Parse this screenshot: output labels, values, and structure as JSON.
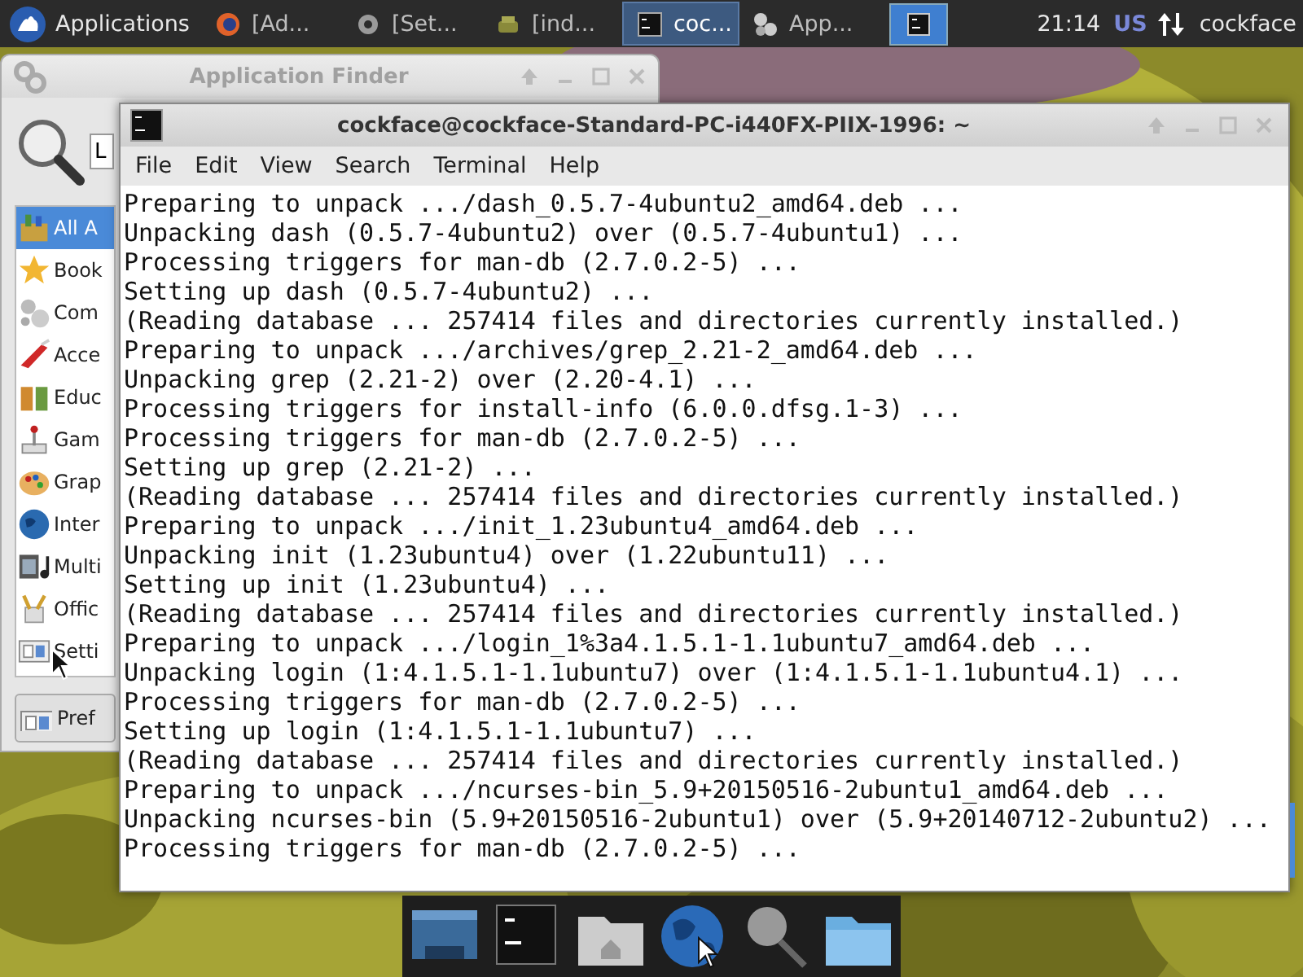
{
  "panel": {
    "menu_label": "Applications",
    "tasks": [
      {
        "label": "[Ad...",
        "kind": "browser",
        "selected": false
      },
      {
        "label": "[Set...",
        "kind": "gear",
        "selected": false
      },
      {
        "label": "[ind...",
        "kind": "package",
        "selected": false
      },
      {
        "label": "coc...",
        "kind": "terminal",
        "selected": true
      },
      {
        "label": "App...",
        "kind": "gears",
        "selected": false
      }
    ],
    "clock": "21:14",
    "layout": "US",
    "user": "cockface"
  },
  "finder": {
    "title": "Application Finder",
    "search_value": "L",
    "categories": [
      {
        "label": "All A",
        "kind": "all",
        "selected": true
      },
      {
        "label": "Book",
        "kind": "star",
        "selected": false
      },
      {
        "label": "Com",
        "kind": "gears",
        "selected": false
      },
      {
        "label": "Acce",
        "kind": "knife",
        "selected": false
      },
      {
        "label": "Educ",
        "kind": "jars",
        "selected": false
      },
      {
        "label": "Gam",
        "kind": "joystick",
        "selected": false
      },
      {
        "label": "Grap",
        "kind": "palette",
        "selected": false
      },
      {
        "label": "Inter",
        "kind": "globe",
        "selected": false
      },
      {
        "label": "Multi",
        "kind": "film",
        "selected": false
      },
      {
        "label": "Offic",
        "kind": "pencils",
        "selected": false
      },
      {
        "label": "Setti",
        "kind": "settings",
        "selected": false
      }
    ],
    "button": "Pref"
  },
  "terminal": {
    "title": "cockface@cockface-Standard-PC-i440FX-PIIX-1996: ~",
    "menu": [
      "File",
      "Edit",
      "View",
      "Search",
      "Terminal",
      "Help"
    ],
    "lines": [
      "Preparing to unpack .../dash_0.5.7-4ubuntu2_amd64.deb ...",
      "Unpacking dash (0.5.7-4ubuntu2) over (0.5.7-4ubuntu1) ...",
      "Processing triggers for man-db (2.7.0.2-5) ...",
      "Setting up dash (0.5.7-4ubuntu2) ...",
      "(Reading database ... 257414 files and directories currently installed.)",
      "Preparing to unpack .../archives/grep_2.21-2_amd64.deb ...",
      "Unpacking grep (2.21-2) over (2.20-4.1) ...",
      "Processing triggers for install-info (6.0.0.dfsg.1-3) ...",
      "Processing triggers for man-db (2.7.0.2-5) ...",
      "Setting up grep (2.21-2) ...",
      "(Reading database ... 257414 files and directories currently installed.)",
      "Preparing to unpack .../init_1.23ubuntu4_amd64.deb ...",
      "Unpacking init (1.23ubuntu4) over (1.22ubuntu11) ...",
      "Setting up init (1.23ubuntu4) ...",
      "(Reading database ... 257414 files and directories currently installed.)",
      "Preparing to unpack .../login_1%3a4.1.5.1-1.1ubuntu7_amd64.deb ...",
      "Unpacking login (1:4.1.5.1-1.1ubuntu7) over (1:4.1.5.1-1.1ubuntu4.1) ...",
      "Processing triggers for man-db (2.7.0.2-5) ...",
      "Setting up login (1:4.1.5.1-1.1ubuntu7) ...",
      "(Reading database ... 257414 files and directories currently installed.)",
      "Preparing to unpack .../ncurses-bin_5.9+20150516-2ubuntu1_amd64.deb ...",
      "Unpacking ncurses-bin (5.9+20150516-2ubuntu1) over (5.9+20140712-2ubuntu2) ...",
      "Processing triggers for man-db (2.7.0.2-5) ..."
    ]
  },
  "dock": {
    "items": [
      {
        "kind": "desktop"
      },
      {
        "kind": "terminal"
      },
      {
        "kind": "home"
      },
      {
        "kind": "globe"
      },
      {
        "kind": "search"
      },
      {
        "kind": "folder"
      }
    ]
  }
}
